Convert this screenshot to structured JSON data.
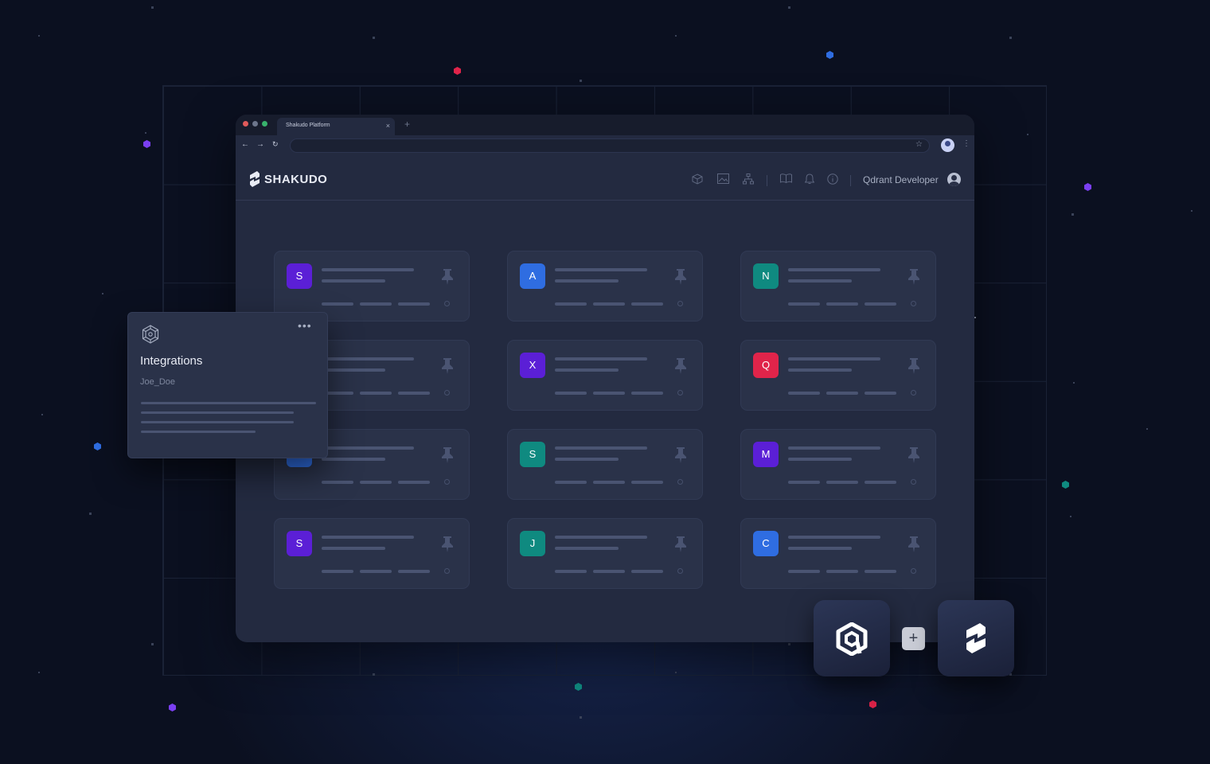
{
  "browser": {
    "tab_title": "Shakudo Platform",
    "tab_close": "×",
    "tab_new": "+",
    "back": "←",
    "forward": "→",
    "reload": "↻",
    "bookmark": "☆",
    "menu": "⋮",
    "url": ""
  },
  "app": {
    "logo_text": "SHAKUDO",
    "username": "Qdrant Developer",
    "header_icons": [
      "cube-icon",
      "image-icon",
      "hierarchy-icon",
      "book-icon",
      "bell-icon",
      "help-icon"
    ]
  },
  "cards": [
    {
      "letter": "S",
      "color": "#5b1fd6"
    },
    {
      "letter": "A",
      "color": "#2f6de1"
    },
    {
      "letter": "N",
      "color": "#0f8a80"
    },
    {
      "letter": "",
      "color": "#2f6de1"
    },
    {
      "letter": "X",
      "color": "#5b1fd6"
    },
    {
      "letter": "Q",
      "color": "#e0244a"
    },
    {
      "letter": "",
      "color": "#2f6de1"
    },
    {
      "letter": "S",
      "color": "#0f8a80"
    },
    {
      "letter": "M",
      "color": "#5b1fd6"
    },
    {
      "letter": "S",
      "color": "#5b1fd6"
    },
    {
      "letter": "J",
      "color": "#0f8a80"
    },
    {
      "letter": "C",
      "color": "#2f6de1"
    }
  ],
  "popup": {
    "title": "Integrations",
    "subtitle": "Joe_Doe",
    "menu": "•••"
  },
  "tiles": {
    "plus": "+",
    "left_logo": "qdrant-logo",
    "right_logo": "shakudo-logo"
  },
  "colors": {
    "background": "#0b1020",
    "browser": "#232a40",
    "card": "#2a3249",
    "purple": "#5b1fd6",
    "blue": "#2f6de1",
    "teal": "#0f8a80",
    "red": "#e0244a"
  }
}
